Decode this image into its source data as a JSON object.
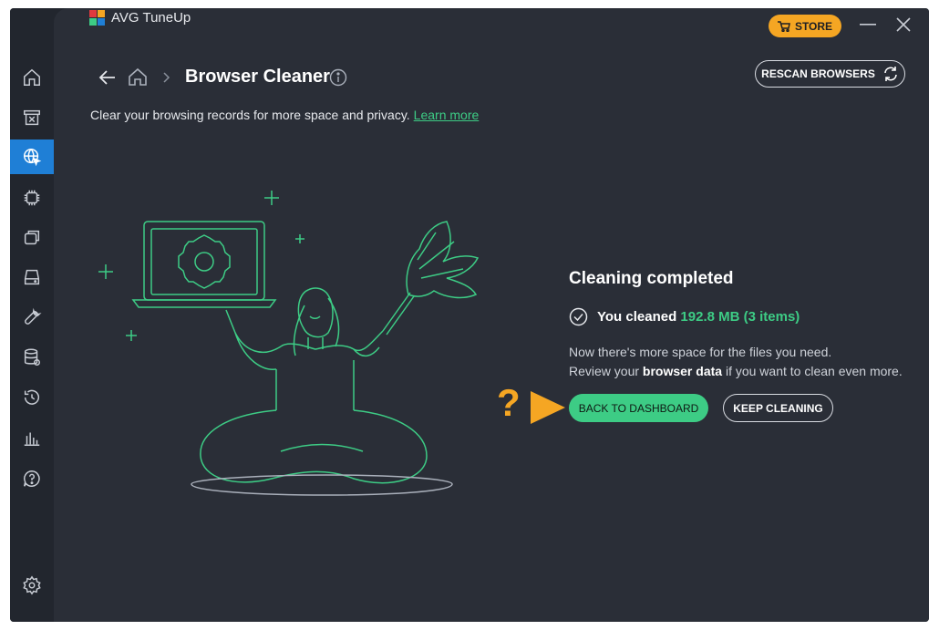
{
  "app": {
    "title": "AVG TuneUp",
    "store_label": "STORE",
    "colors": {
      "accent_green": "#3dcc85",
      "store_orange": "#f5a623",
      "active_blue": "#1f7fd6"
    }
  },
  "sidebar": {
    "items": [
      {
        "icon": "home-icon"
      },
      {
        "icon": "archive-icon"
      },
      {
        "icon": "globe-cursor-icon",
        "active": true
      },
      {
        "icon": "chip-icon"
      },
      {
        "icon": "windows-icon"
      },
      {
        "icon": "drive-icon"
      },
      {
        "icon": "wrench-icon"
      },
      {
        "icon": "database-icon"
      },
      {
        "icon": "history-icon"
      },
      {
        "icon": "chart-icon"
      },
      {
        "icon": "help-icon"
      }
    ],
    "settings_icon": "gear-icon"
  },
  "header": {
    "page_title": "Browser Cleaner",
    "subtitle": "Clear your browsing records for more space and privacy.",
    "learn_more": "Learn more",
    "rescan_label": "RESCAN BROWSERS"
  },
  "result": {
    "title": "Cleaning completed",
    "cleaned_prefix": "You cleaned",
    "cleaned_amount": "192.8 MB (3 items)",
    "desc_line1": "Now there's more space for the files you need.",
    "desc_line2_pre": "Review your",
    "desc_line2_bold": "browser data",
    "desc_line2_post": "if you want to clean even more.",
    "primary_button": "BACK TO DASHBOARD",
    "secondary_button": "KEEP CLEANING",
    "annotation_mark": "?"
  }
}
